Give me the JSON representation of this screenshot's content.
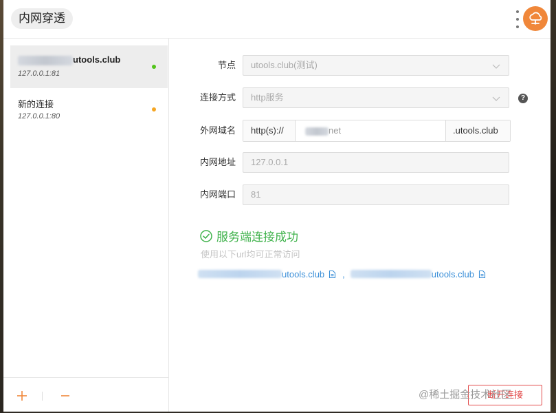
{
  "app": {
    "title": "内网穿透",
    "menu_icon": "kebab-menu-icon",
    "logo_icon": "cloud-logo-icon"
  },
  "connections": [
    {
      "name_suffix": "utools.club",
      "address": "127.0.0.1:81",
      "status_color": "#52c41a",
      "active": true
    },
    {
      "name": "新的连接",
      "address": "127.0.0.1:80",
      "status_color": "#f5a623",
      "active": false
    }
  ],
  "sidebar_footer": {
    "add_icon": "plus-icon",
    "remove_icon": "minus-icon"
  },
  "form": {
    "node": {
      "label": "节点",
      "value": "utools.club(测试)"
    },
    "method": {
      "label": "连接方式",
      "value": "http服务",
      "help": "?"
    },
    "domain": {
      "label": "外网域名",
      "prefix": "http(s)://",
      "value_suffix": "net",
      "suffix": ".utools.club"
    },
    "internal_address": {
      "label": "内网地址",
      "placeholder": "127.0.0.1"
    },
    "internal_port": {
      "label": "内网端口",
      "placeholder": "81"
    }
  },
  "status": {
    "success_text": "服务端连接成功",
    "hint": "使用以下url均可正常访问",
    "url1_suffix": "utools.club",
    "separator": ",",
    "url2_suffix": "utools.club",
    "success_color": "#3fb24b",
    "link_color": "#3b8fd8"
  },
  "actions": {
    "disconnect_label": "断开连接",
    "disconnect_color": "#e24a4a"
  },
  "watermark": "@稀土掘金技术社区"
}
